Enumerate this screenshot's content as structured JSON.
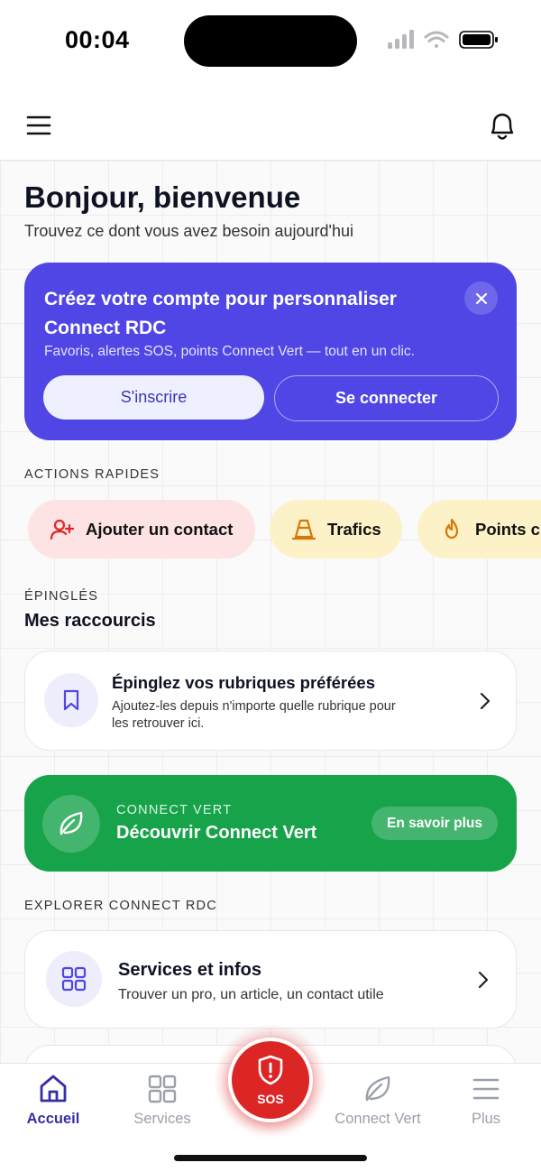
{
  "status_bar": {
    "time": "00:04"
  },
  "greeting": {
    "title": "Bonjour, bienvenue",
    "subtitle": "Trouvez ce dont vous avez besoin aujourd'hui"
  },
  "promo": {
    "title": "Créez votre compte pour personnaliser Connect RDC",
    "description": "Favoris, alertes SOS, points Connect Vert — tout en un clic.",
    "signup_label": "S'inscrire",
    "login_label": "Se connecter"
  },
  "quick_actions": {
    "label": "ACTIONS RAPIDES",
    "items": [
      {
        "label": "Ajouter un contact",
        "icon": "add-user-icon",
        "bg": "#fde3e3"
      },
      {
        "label": "Trafics",
        "icon": "traffic-cone-icon",
        "bg": "#fdf1c7"
      },
      {
        "label": "Points ch",
        "icon": "flame-icon",
        "bg": "#fdf1c7"
      }
    ]
  },
  "pinned": {
    "label": "ÉPINGLÉS",
    "title": "Mes raccourcis",
    "card_title": "Épinglez vos rubriques préférées",
    "card_desc_line1": "Ajoutez-les depuis n'importe quelle rubrique pour",
    "card_desc_line2": "les retrouver ici."
  },
  "connect_vert": {
    "eyebrow": "CONNECT VERT",
    "title": "Découvrir Connect Vert",
    "button": "En savoir plus"
  },
  "explore": {
    "label": "EXPLORER CONNECT RDC",
    "card_title": "Services et infos",
    "card_desc": "Trouver un pro, un article, un contact utile"
  },
  "tabs": [
    {
      "label": "Accueil",
      "icon": "home-icon",
      "active": true
    },
    {
      "label": "Services",
      "icon": "grid-icon",
      "active": false
    },
    {
      "label": "Connect Vert",
      "icon": "leaf-icon",
      "active": false
    },
    {
      "label": "Plus",
      "icon": "menu-icon",
      "active": false
    }
  ],
  "sos": {
    "label": "SOS"
  },
  "colors": {
    "primary": "#4f46e5",
    "green": "#16a34a",
    "sos_red": "#dc2626",
    "tab_active": "#3730a3",
    "tab_inactive": "#9aa0aa"
  }
}
